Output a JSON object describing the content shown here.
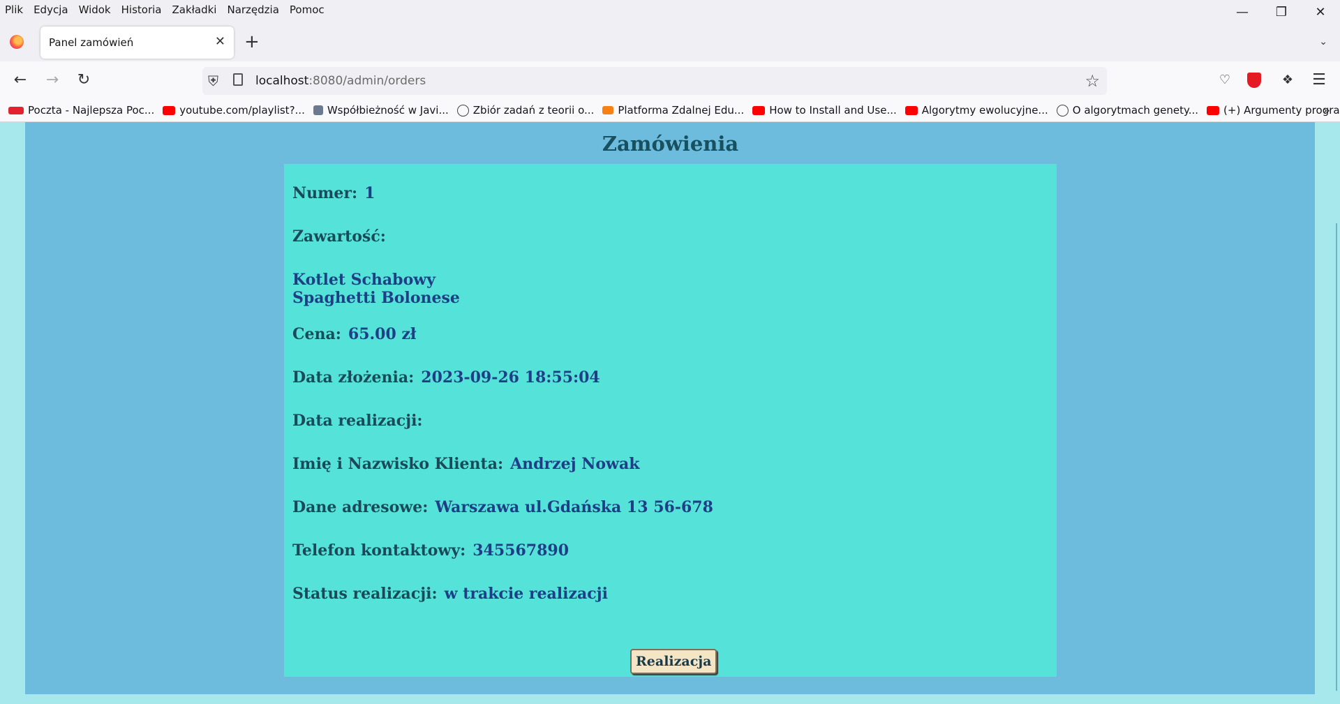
{
  "menu": [
    "Plik",
    "Edycja",
    "Widok",
    "Historia",
    "Zakładki",
    "Narzędzia",
    "Pomoc"
  ],
  "window_controls": {
    "minimize": "—",
    "restore": "❐",
    "close": "✕"
  },
  "tab": {
    "title": "Panel zamówień",
    "close": "✕",
    "new_tab": "+"
  },
  "nav": {
    "back": "←",
    "forward": "→",
    "reload": "↻"
  },
  "url": {
    "host": "localhost",
    "rest": ":8080/admin/orders"
  },
  "toolbar_icons": [
    "pocket-icon",
    "ublock-icon",
    "extensions-icon",
    "menu-icon"
  ],
  "bookmarks": [
    {
      "label": "Poczta - Najlepsza Poc...",
      "icon": "wp-icon"
    },
    {
      "label": "youtube.com/playlist?...",
      "icon": "youtube-icon"
    },
    {
      "label": "Współbieżność w Javi...",
      "icon": "site-icon"
    },
    {
      "label": "Zbiór zadań z teorii o...",
      "icon": "globe-icon"
    },
    {
      "label": "Platforma Zdalnej Edu...",
      "icon": "moodle-icon"
    },
    {
      "label": "How to Install and Use...",
      "icon": "youtube-icon"
    },
    {
      "label": "Algorytmy ewolucyjne...",
      "icon": "youtube-icon"
    },
    {
      "label": "O algorytmach genety...",
      "icon": "globe-icon"
    },
    {
      "label": "(+) Argumenty progra...",
      "icon": "youtube-icon"
    }
  ],
  "page": {
    "title": "Zamówienia",
    "order": {
      "number_label": "Numer:",
      "number_value": "1",
      "contents_label": "Zawartość:",
      "items": [
        "Kotlet Schabowy",
        "Spaghetti Bolonese"
      ],
      "price_label": "Cena:",
      "price_value": "65.00 zł",
      "placed_label": "Data złożenia:",
      "placed_value": "2023-09-26 18:55:04",
      "completed_label": "Data realizacji:",
      "completed_value": "",
      "client_label": "Imię i Nazwisko Klienta:",
      "client_value": "Andrzej  Nowak",
      "address_label": "Dane adresowe:",
      "address_value": "Warszawa  ul.Gdańska 13  56-678",
      "phone_label": "Telefon kontaktowy:",
      "phone_value": "345567890",
      "status_label": "Status realizacji:",
      "status_value": "w trakcie realizacji",
      "button_label": "Realizacja"
    }
  }
}
